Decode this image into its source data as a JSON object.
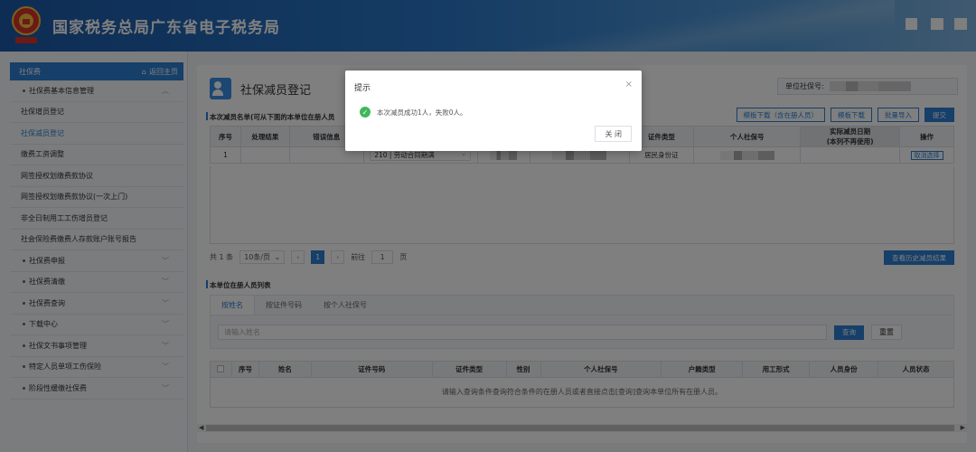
{
  "header": {
    "title": "国家税务总局广东省电子税务局",
    "emblem_text": "国家税务"
  },
  "sidebar": {
    "head_label": "社保费",
    "home_label": "返回主页",
    "items": [
      {
        "label": "社保费基本信息管理",
        "expanded": true
      },
      {
        "label": "社保增员登记"
      },
      {
        "label": "社保减员登记",
        "active": true
      },
      {
        "label": "缴费工资调整"
      },
      {
        "label": "网签授权划缴费款协议"
      },
      {
        "label": "网签授权划缴费款协议(一次上门)"
      },
      {
        "label": "非全日制用工工伤增员登记"
      },
      {
        "label": "社会保险费缴费人存款账户账号报告"
      },
      {
        "label": "社保费申报"
      },
      {
        "label": "社保费清缴"
      },
      {
        "label": "社保费查询"
      },
      {
        "label": "下载中心"
      },
      {
        "label": "社保文书事项管理"
      },
      {
        "label": "特定人员单项工伤保险"
      },
      {
        "label": "阶段性缓缴社保费"
      }
    ]
  },
  "main": {
    "title": "社保减员登记",
    "unit_label": "单位社保号:",
    "section1_label": "本次减员名单(可从下面的本单位在册人员",
    "toolbar": {
      "template_with": "模板下载（含在册人员）",
      "template": "模板下载",
      "import": "批量导入",
      "submit": "提交"
    },
    "table1": {
      "headers": [
        "序号",
        "处理结果",
        "错误信息",
        "",
        "",
        "",
        "证件类型",
        "个人社保号",
        "实际减员日期",
        "操作"
      ],
      "date_header_line1": "实际减员日期",
      "date_header_line2": "(本列不再使用)",
      "row": {
        "seq": "1",
        "reason": "210 | 劳动合同期满",
        "id_type": "居民身份证",
        "action": "取消选择"
      }
    },
    "pager": {
      "total": "共 1 条",
      "page_size": "10条/页",
      "current": "1",
      "goto_label": "前往",
      "goto_value": "1",
      "page_unit": "页"
    },
    "history_button": "查看历史减员结果",
    "section2_label": "本单位在册人员列表",
    "tabs": [
      "按姓名",
      "按证件号码",
      "按个人社保号"
    ],
    "search": {
      "placeholder": "请输入姓名",
      "search_button": "查询",
      "reset_button": "重置"
    },
    "table2": {
      "headers": [
        "序号",
        "姓名",
        "证件号码",
        "证件类型",
        "性别",
        "个人社保号",
        "户籍类型",
        "用工形式",
        "人员身份",
        "人员状态"
      ],
      "empty_text": "请输入查询条件查询符合条件的在册人员或者直接点击[查询]查询本单位所有在册人员。"
    }
  },
  "dialog": {
    "title": "提示",
    "message": "本次减员成功1人，失败0人。",
    "close_button": "关 闭"
  },
  "colors": {
    "primary": "#2d7fd2",
    "success": "#3eb85a"
  }
}
